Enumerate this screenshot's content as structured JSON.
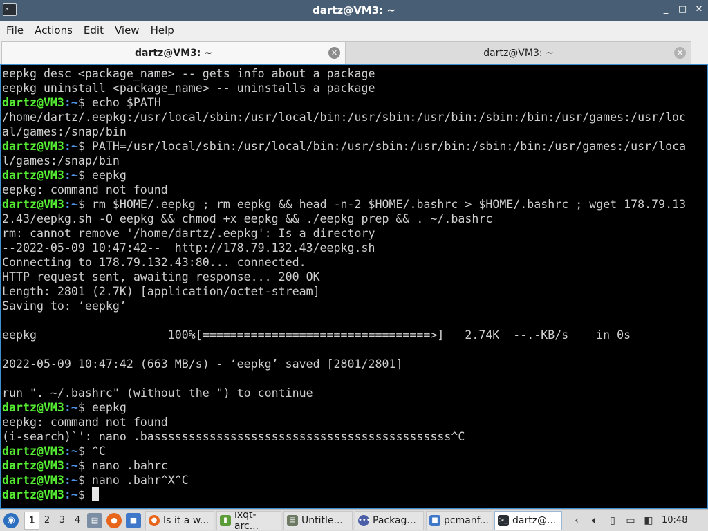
{
  "window": {
    "title": "dartz@VM3: ~",
    "controls": [
      "_",
      "□",
      "✕"
    ]
  },
  "menu": [
    "File",
    "Actions",
    "Edit",
    "View",
    "Help"
  ],
  "tabs": [
    {
      "label": "dartz@VM3: ~",
      "active": true
    },
    {
      "label": "dartz@VM3: ~",
      "active": false
    }
  ],
  "prompt": {
    "user": "dartz@VM3",
    "path": "~",
    "symbol": "$"
  },
  "terminal_lines": [
    {
      "type": "out",
      "text": "eepkg desc <package_name> -- gets info about a package"
    },
    {
      "type": "out",
      "text": "eepkg uninstall <package_name> -- uninstalls a package"
    },
    {
      "type": "prompt",
      "text": " echo $PATH"
    },
    {
      "type": "out",
      "text": "/home/dartz/.eepkg:/usr/local/sbin:/usr/local/bin:/usr/sbin:/usr/bin:/sbin:/bin:/usr/games:/usr/loc"
    },
    {
      "type": "out",
      "text": "al/games:/snap/bin"
    },
    {
      "type": "prompt",
      "text": " PATH=/usr/local/sbin:/usr/local/bin:/usr/sbin:/usr/bin:/sbin:/bin:/usr/games:/usr/loca"
    },
    {
      "type": "out",
      "text": "l/games:/snap/bin"
    },
    {
      "type": "prompt",
      "text": " eepkg"
    },
    {
      "type": "out",
      "text": "eepkg: command not found"
    },
    {
      "type": "prompt",
      "text": " rm $HOME/.eepkg ; rm eepkg && head -n-2 $HOME/.bashrc > $HOME/.bashrc ; wget 178.79.13"
    },
    {
      "type": "out",
      "text": "2.43/eepkg.sh -O eepkg && chmod +x eepkg && ./eepkg prep && . ~/.bashrc"
    },
    {
      "type": "out",
      "text": "rm: cannot remove '/home/dartz/.eepkg': Is a directory"
    },
    {
      "type": "out",
      "text": "--2022-05-09 10:47:42--  http://178.79.132.43/eepkg.sh"
    },
    {
      "type": "out",
      "text": "Connecting to 178.79.132.43:80... connected."
    },
    {
      "type": "out",
      "text": "HTTP request sent, awaiting response... 200 OK"
    },
    {
      "type": "out",
      "text": "Length: 2801 (2.7K) [application/octet-stream]"
    },
    {
      "type": "out",
      "text": "Saving to: ‘eepkg’"
    },
    {
      "type": "out",
      "text": ""
    },
    {
      "type": "out",
      "text": "eepkg                   100%[=================================>]   2.74K  --.-KB/s    in 0s"
    },
    {
      "type": "out",
      "text": ""
    },
    {
      "type": "out",
      "text": "2022-05-09 10:47:42 (663 MB/s) - ‘eepkg’ saved [2801/2801]"
    },
    {
      "type": "out",
      "text": ""
    },
    {
      "type": "out",
      "text": "run \". ~/.bashrc\" (without the \") to continue"
    },
    {
      "type": "prompt",
      "text": " eepkg"
    },
    {
      "type": "out",
      "text": "eepkg: command not found"
    },
    {
      "type": "out",
      "text": "(i-search)`': nano .basssssssssssssssssssssssssssssssssssssssssss^C"
    },
    {
      "type": "prompt",
      "text": " ^C"
    },
    {
      "type": "prompt",
      "text": " nano .bahrc"
    },
    {
      "type": "prompt",
      "text": " nano .bahr^X^C"
    },
    {
      "type": "prompt_cursor",
      "text": " "
    }
  ],
  "taskbar": {
    "desktops": [
      "1",
      "2",
      "3",
      "4"
    ],
    "active_desktop": "1",
    "quicklaunch": [
      "files-icon",
      "firefox-icon",
      "folder-icon"
    ],
    "tasks": [
      {
        "label": "Is it a w...",
        "icon": "firefox-icon",
        "active": false
      },
      {
        "label": "lxqt-arc...",
        "icon": "archive-icon",
        "active": false
      },
      {
        "label": "Untitle...",
        "icon": "text-editor-icon",
        "active": false
      },
      {
        "label": "Packag...",
        "icon": "package-icon",
        "active": false
      },
      {
        "label": "pcmanf...",
        "icon": "folder-icon",
        "active": false
      },
      {
        "label": "dartz@...",
        "icon": "terminal-icon",
        "active": true
      }
    ],
    "tray": [
      "chevron-icon",
      "volume-icon",
      "clipboard-icon",
      "battery-icon",
      "network-icon"
    ],
    "clock": "10:48"
  },
  "colors": {
    "titlebar": "#485e74",
    "prompt_user": "#55ee33",
    "prompt_path": "#4f94e8",
    "terminal_bg": "#000000",
    "terminal_fg": "#cfcfcf"
  }
}
